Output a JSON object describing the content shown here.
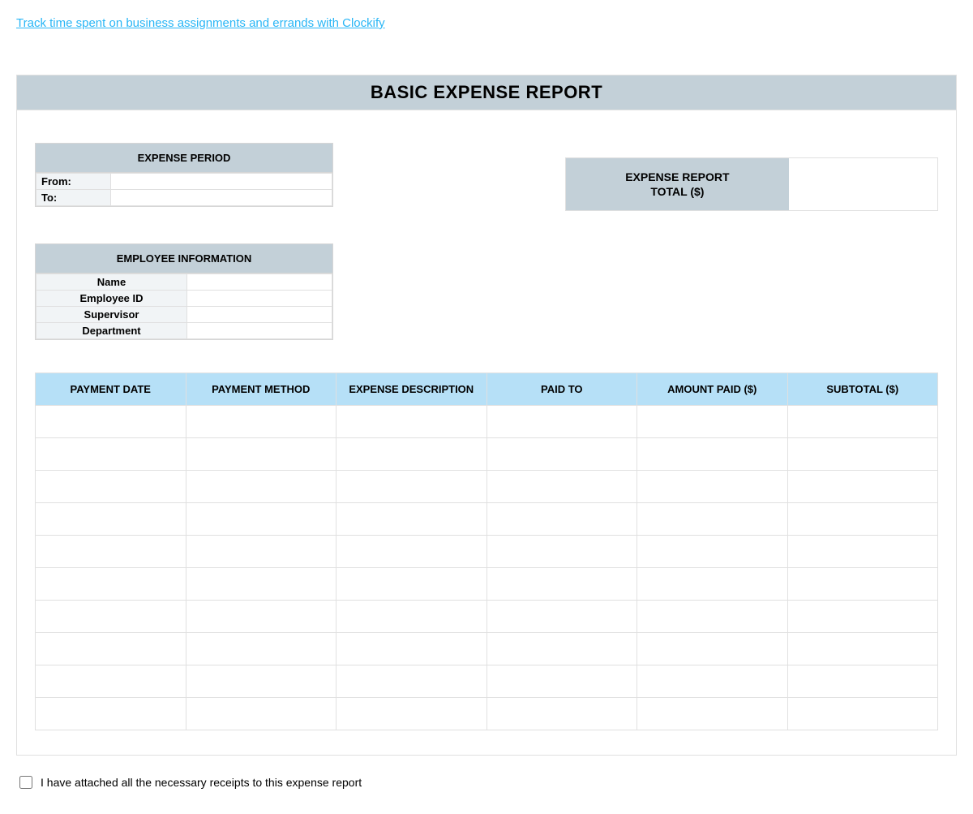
{
  "top_link": "Track time spent on business assignments and errands with Clockify",
  "report_title": "BASIC EXPENSE REPORT",
  "expense_period": {
    "header": "EXPENSE PERIOD",
    "from_label": "From:",
    "from_value": "",
    "to_label": "To:",
    "to_value": ""
  },
  "total_box": {
    "label_line1": "EXPENSE REPORT",
    "label_line2": "TOTAL ($)",
    "value": ""
  },
  "employee_info": {
    "header": "EMPLOYEE INFORMATION",
    "rows": [
      {
        "label": "Name",
        "value": ""
      },
      {
        "label": "Employee ID",
        "value": ""
      },
      {
        "label": "Supervisor",
        "value": ""
      },
      {
        "label": "Department",
        "value": ""
      }
    ]
  },
  "expense_columns": [
    "PAYMENT DATE",
    "PAYMENT METHOD",
    "EXPENSE DESCRIPTION",
    "PAID TO",
    "AMOUNT PAID ($)",
    "SUBTOTAL ($)"
  ],
  "expense_row_count": 10,
  "confirmation_text": "I have attached all the necessary receipts to this expense report",
  "confirmation_checked": false
}
